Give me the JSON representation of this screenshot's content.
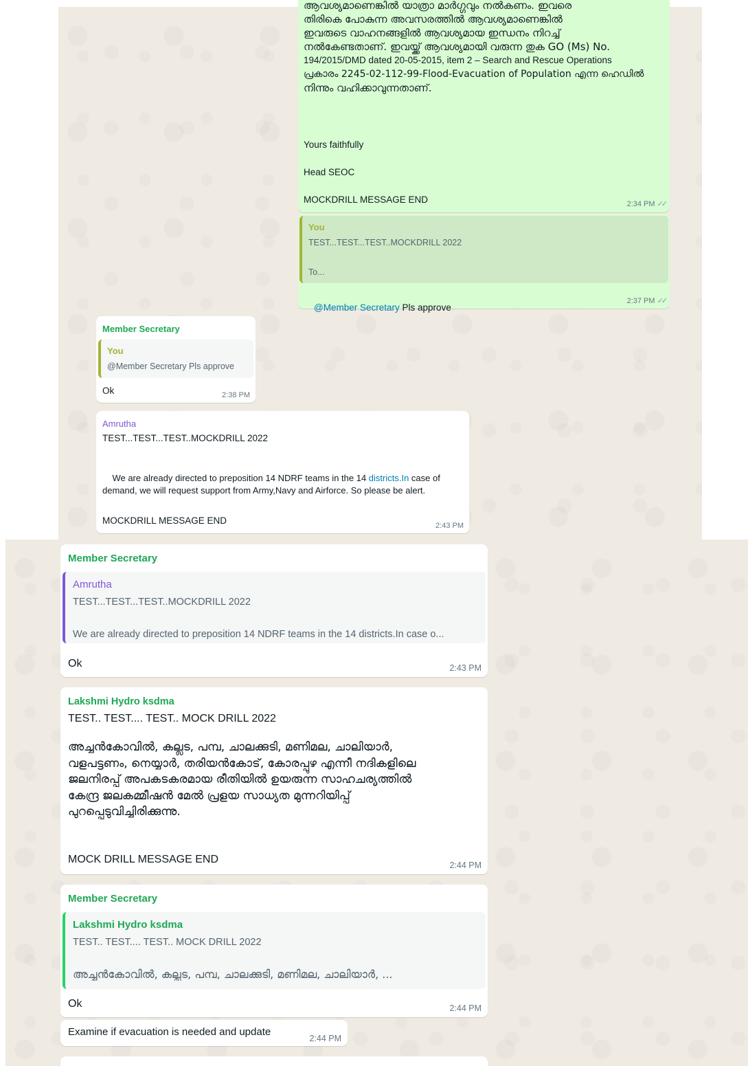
{
  "colors": {
    "member_secretary": "#1fa855",
    "you": "#a5b337",
    "amrutha": "#7f56d9",
    "lakshmi": "#25d366",
    "outgoing_bubble": "#d9fdd3",
    "incoming_bubble": "#ffffff",
    "chat_background": "#efeae2"
  },
  "top_section": {
    "msg1": {
      "partial_line": "ആവശ്യമാണെങ്കിൽ യാത്രാ മാർഗ്ഗവും നൽകണം. ഇവരെ",
      "lines": [
        "തിരികെ പോകുന്ന അവസരത്തിൽ ആവശ്യമാണെങ്കിൽ",
        "ഇവരുടെ വാഹനങ്ങളിൽ ആവശ്യമായ ഇന്ധനം നിറച്ച്",
        "നൽകേണ്ടതാണ്. ഇവയ്ക്ക് ആവശ്യമായി വരുന്ന തുക GO (Ms) No.",
        "194/2015/DMD dated 20-05-2015, item 2 – Search and Rescue Operations",
        "പ്രകാരം 2245-02-112-99-Flood-Evacuation of Population എന്ന ഹെഡിൽ",
        "നിന്നും വഹിക്കാവുന്നതാണ്."
      ],
      "closing": "Yours faithfully",
      "signature": "Head SEOC",
      "end": "MOCKDRILL MESSAGE END",
      "time": "2:34 PM"
    },
    "msg2": {
      "quote_sender": "You",
      "quote_line1": "TEST...TEST...TEST..MOCKDRILL 2022",
      "quote_line2": "To...",
      "mention": "@Member Secretary",
      "text": "Pls approve",
      "time": "2:37 PM"
    },
    "msg3": {
      "sender": "Member Secretary",
      "quote_sender": "You",
      "quote_text": "@Member Secretary Pls approve",
      "text": "Ok",
      "time": "2:38 PM"
    },
    "msg4": {
      "sender": "Amrutha",
      "line1": "TEST...TEST...TEST..MOCKDRILL 2022",
      "body_pre": "We are already directed to preposition 14 NDRF teams in the 14 ",
      "body_link": "districts.In",
      "body_post": " case of demand, we will request support from Army,Navy and Airforce. So please be alert.",
      "end": "MOCKDRILL MESSAGE END",
      "time": "2:43 PM"
    }
  },
  "bottom_section": {
    "msg5": {
      "sender": "Member Secretary",
      "quote_sender": "Amrutha",
      "quote_line1": "TEST...TEST...TEST..MOCKDRILL 2022",
      "quote_line2": "We are already directed to preposition 14 NDRF teams in the 14 districts.In case o...",
      "text": "Ok",
      "time": "2:43 PM"
    },
    "msg6": {
      "sender": "Lakshmi Hydro ksdma",
      "line1": "TEST.. TEST.... TEST.. MOCK DRILL 2022",
      "ml_lines": [
        "അച്ചൻകോവിൽ, കല്ലട, പമ്പ,  ചാലക്കുടി, മണിമല, ചാലിയാർ,",
        "വളപട്ടണം, നെയ്യാർ, തരിയൻകോട്, കോരപ്പുഴ എന്നീ നദികളിലെ",
        "ജലനിരപ്പ് അപകടകരമായ രീതിയിൽ ഉയരുന്ന സാഹചര്യത്തിൽ",
        "കേന്ദ്ര ജലകമ്മീഷൻ മേൽ പ്രളയ സാധ്യത മുന്നറിയിപ്പ്",
        "പുറപ്പെടുവിച്ചിരിക്കുന്നു."
      ],
      "end": "MOCK DRILL MESSAGE END",
      "time": "2:44 PM"
    },
    "msg7": {
      "sender": "Member Secretary",
      "quote_sender": "Lakshmi Hydro ksdma",
      "quote_line1": "TEST.. TEST.... TEST.. MOCK DRILL 2022",
      "quote_line2": "അച്ചൻകോവിൽ, കല്ലട, പമ്പ,  ചാലക്കുടി, മണിമല, ചാലിയാർ, ...",
      "text": "Ok",
      "time": "2:44 PM"
    },
    "msg8": {
      "text": "Examine if evacuation is needed and update",
      "time": "2:44 PM"
    }
  }
}
